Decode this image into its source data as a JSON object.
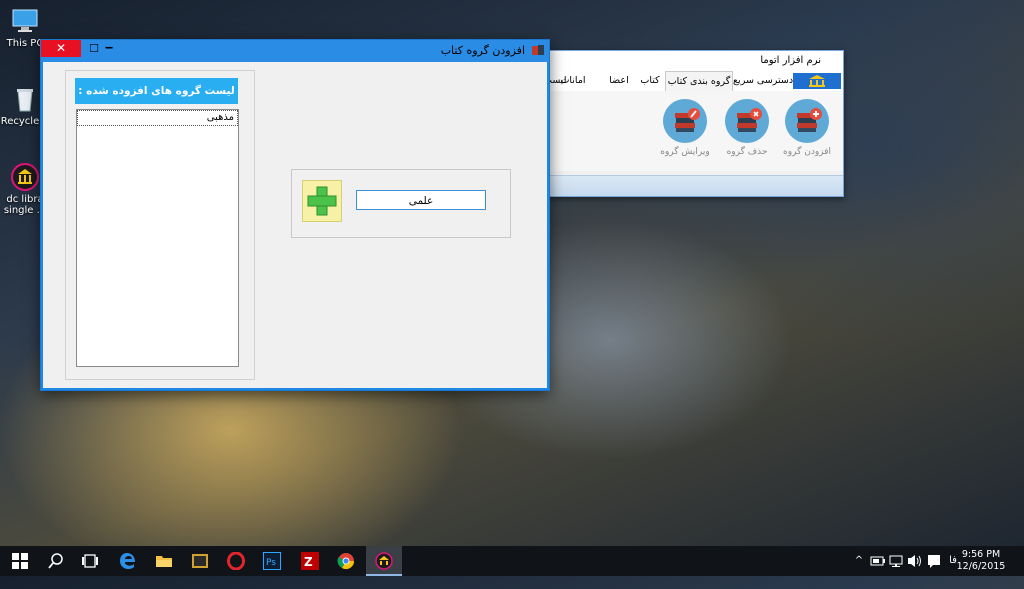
{
  "desktop": {
    "icons": [
      {
        "label": "This PC"
      },
      {
        "label": "Recycle B"
      },
      {
        "label_line1": "dc libra",
        "label_line2": "single ..."
      }
    ]
  },
  "main_window": {
    "title": "نرم افزار اتوما",
    "tabs": [
      "دسترسی سریع",
      "گروه بندی کتاب",
      "کتاب",
      "اعضا",
      "امانات",
      "لیست"
    ],
    "ribbon_buttons": [
      "افزودن گروه",
      "حذف گروه",
      "ویرایش گروه"
    ],
    "colors": {
      "app_tab": "#1e6fd0",
      "ribbon_circle": "#5fa9d6"
    }
  },
  "dialog": {
    "title": "افزودن گروه کتاب",
    "close_glyph": "✕",
    "max_glyph": "☐",
    "min_glyph": "‒",
    "list_header": "لیست گروه های افزوده شده :",
    "list_items": [
      "مذهبی"
    ],
    "input_value": "علمی",
    "colors": {
      "border": "#1e88e5",
      "header": "#29aef2",
      "close": "#e81123"
    }
  },
  "taskbar": {
    "language": "فا",
    "time": "9:56 PM",
    "date": "12/6/2015",
    "tray_up_glyph": "^"
  }
}
